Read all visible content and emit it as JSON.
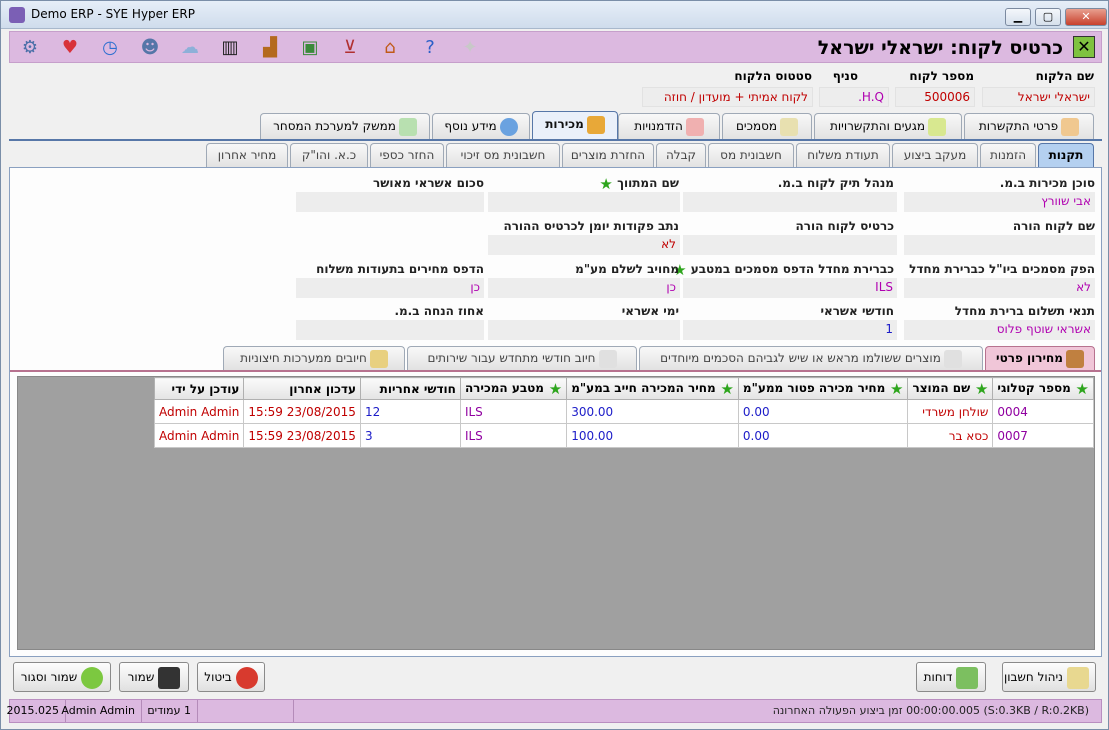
{
  "window": {
    "title": "Demo ERP - SYE Hyper ERP",
    "min": "▁",
    "max": "▢",
    "close": "✕"
  },
  "toolbar": {
    "icons": [
      "gear-icon",
      "heart-icon",
      "clock-icon",
      "user-icon",
      "cloud-icon",
      "barcode-icon",
      "factory-icon",
      "money-icon",
      "basket-icon",
      "home-icon",
      "help-icon",
      "bulb-icon"
    ],
    "close_label": "✕",
    "page_title": "כרטיס לקוח: ישראלי ישראל"
  },
  "header": {
    "customer_name_label": "שם הלקוח",
    "customer_number_label": "מספר לקוח",
    "branch_label": "סניף",
    "status_label": "סטטוס הלקוח",
    "customer_name": "ישראלי ישראל",
    "customer_number": "500006",
    "branch": "H.Q.",
    "status": "לקוח אמיתי + מועדון / חוזה"
  },
  "main_tabs": [
    "פרטי התקשרות",
    "מגעים והתקשרויות",
    "מסמכים",
    "הזדמנויות",
    "מכירות",
    "מידע נוסף",
    "ממשק למערכת המסחר"
  ],
  "sub_tabs": [
    "תקנות",
    "הזמנות",
    "מעקב ביצוע",
    "תעודת משלוח",
    "חשבונית מס",
    "קבלה",
    "החזרת מוצרים",
    "חשבונית מס זיכוי",
    "החזר כספי",
    "כ.א. והו\"ק",
    "מחיר אחרון"
  ],
  "fields": {
    "sales_agent_label": "סוכן מכירות ב.מ.",
    "sales_agent": "אבי שוורץ",
    "account_manager_label": "מנהל תיק לקוח ב.מ.",
    "account_manager": "",
    "recommender_label": "שם המתווך",
    "recommender": "",
    "credit_amount_label": "סכום אשראי מאושר",
    "credit_amount": "",
    "parent_name_label": "שם לקוח הורה",
    "parent_name": "",
    "parent_card_label": "כרטיס לקוח הורה",
    "parent_card": "",
    "journal_label": "נתב פקודות יומן לכרטיס ההורה",
    "journal": "לא",
    "export_docs_label": "הפק מסמכים ביו\"ל כברירת מחדל",
    "export_docs": "לא",
    "default_currency_label": "כברירת מחדל הדפס מסמכים במטבע",
    "default_currency": "ILS",
    "vat_label": "מחויב לשלם מע\"מ",
    "vat": "כן",
    "print_prices_label": "הדפס מחירים בתעודות משלוח",
    "print_prices": "כן",
    "payment_terms_label": "תנאי תשלום ברירת מחדל",
    "payment_terms": "אשראי שוטף פלוס",
    "credit_months_label": "חודשי אשראי",
    "credit_months": "1",
    "credit_days_label": "ימי אשראי",
    "credit_days": "",
    "discount_label": "אחוז הנחה ב.מ.",
    "discount": ""
  },
  "inner_tabs": [
    "מחירון פרטי",
    "מוצרים ששולמו מראש או שיש לגביהם הסכמים מיוחדים",
    "חיוב חודשי מתחדש עבור שירותים",
    "חיובים ממערכות חיצוניות"
  ],
  "table": {
    "columns": [
      "מספר קטלוגי",
      "שם המוצר",
      "מחיר מכירה פטור ממע\"מ",
      "מחיר המכירה חייב במע\"מ",
      "מטבע המכירה",
      "חודשי אחריות",
      "עדכון אחרון",
      "עודכן על ידי"
    ],
    "rows": [
      [
        "0004",
        "שולחן משרדי",
        "0.00",
        "300.00",
        "ILS",
        "12",
        "23/08/2015 15:59",
        "Admin Admin"
      ],
      [
        "0007",
        "כסא בר",
        "0.00",
        "100.00",
        "ILS",
        "3",
        "23/08/2015 15:59",
        "Admin Admin"
      ]
    ]
  },
  "buttons": {
    "account_mgmt": "ניהול חשבון",
    "reports": "דוחות",
    "cancel": "ביטול",
    "save": "שמור",
    "save_close": "שמור וסגור"
  },
  "status": {
    "version": "2015.025",
    "user": "Admin Admin",
    "pages": "1 עמודים",
    "info": "(S:0.3KB / R:0.2KB)  00:00:00.005  זמן ביצוע הפעולה האחרונה"
  },
  "colors": {
    "toolbar": "#dcb9e0",
    "accent_blue": "#1c1cc8",
    "accent_red": "#c00000",
    "accent_purple": "#b000b0"
  }
}
